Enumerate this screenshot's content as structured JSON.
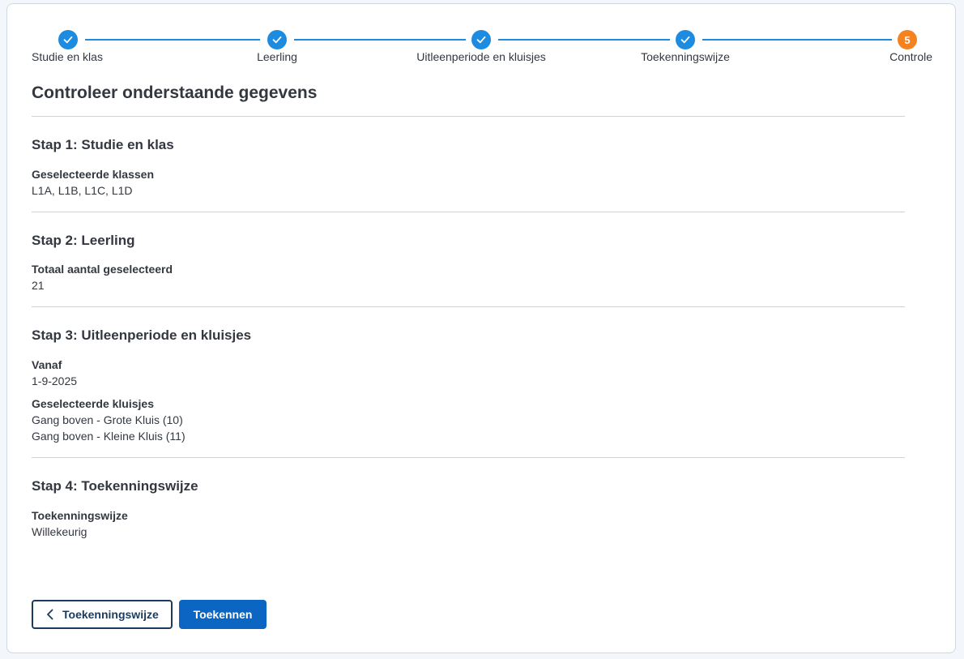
{
  "stepper": {
    "steps": [
      {
        "label": "Studie en klas",
        "state": "done",
        "icon": "check-icon"
      },
      {
        "label": "Leerling",
        "state": "done",
        "icon": "check-icon"
      },
      {
        "label": "Uitleenperiode en kluisjes",
        "state": "done",
        "icon": "check-icon"
      },
      {
        "label": "Toekenningswijze",
        "state": "done",
        "icon": "check-icon"
      },
      {
        "label": "Controle",
        "state": "current",
        "number": "5"
      }
    ]
  },
  "page": {
    "title": "Controleer onderstaande gegevens"
  },
  "sections": [
    {
      "title": "Stap 1: Studie en klas",
      "fields": [
        {
          "label": "Geselecteerde klassen",
          "values": [
            "L1A, L1B, L1C, L1D"
          ]
        }
      ]
    },
    {
      "title": "Stap 2: Leerling",
      "fields": [
        {
          "label": "Totaal aantal geselecteerd",
          "values": [
            "21"
          ]
        }
      ]
    },
    {
      "title": "Stap 3: Uitleenperiode en kluisjes",
      "fields": [
        {
          "label": "Vanaf",
          "values": [
            "1-9-2025"
          ]
        },
        {
          "label": "Geselecteerde kluisjes",
          "values": [
            "Gang boven - Grote Kluis (10)",
            "Gang boven - Kleine Kluis (11)"
          ]
        }
      ]
    },
    {
      "title": "Stap 4: Toekenningswijze",
      "fields": [
        {
          "label": "Toekenningswijze",
          "values": [
            "Willekeurig"
          ]
        }
      ]
    }
  ],
  "buttons": {
    "back_label": "Toekenningswijze",
    "back_icon": "chevron-left-icon",
    "submit_label": "Toekennen"
  },
  "colors": {
    "accent": "#1d8be0",
    "current_step": "#f58220",
    "primary_button": "#0a66c2",
    "back_button_border": "#1c3a5c"
  }
}
